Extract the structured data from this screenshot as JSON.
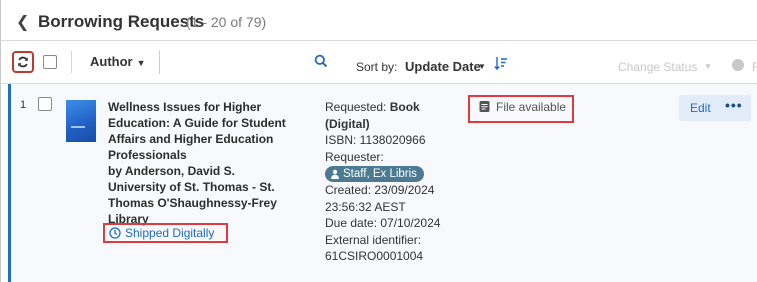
{
  "header": {
    "title": "Borrowing Requests",
    "count": "(1 - 20 of 79)"
  },
  "toolbar": {
    "filter_field": "Author",
    "search_value": "",
    "sort_label": "Sort by:",
    "sort_value": "Update Date",
    "change_status": "Change Status",
    "more_label": "F"
  },
  "rows": [
    {
      "number": "1",
      "title_lines": [
        "Wellness Issues for Higher",
        "Education: A Guide for Student",
        "Affairs and Higher Education",
        "Professionals"
      ],
      "author": "by Anderson, David S.",
      "library_lines": [
        "University of St. Thomas - St.",
        "Thomas O'Shaughnessy-Frey Library"
      ],
      "status": "Shipped Digitally",
      "requested_label": "Requested:",
      "requested_value_1": "Book",
      "requested_value_2": "(Digital)",
      "isbn": "ISBN: 1138020966",
      "requester_label": "Requester:",
      "requester": "Staff, Ex Libris",
      "created_1": "Created: 23/09/2024",
      "created_2": "23:56:32 AEST",
      "due_date": "Due date: 07/10/2024",
      "external_label": "External identifier:",
      "external_id": "61CSIRO0001004",
      "file_status": "File available",
      "edit_label": "Edit",
      "more_label": "•••"
    }
  ],
  "colors": {
    "accent": "#1f6fc5",
    "highlight": "#e0393e",
    "pill": "#4c7a92"
  }
}
